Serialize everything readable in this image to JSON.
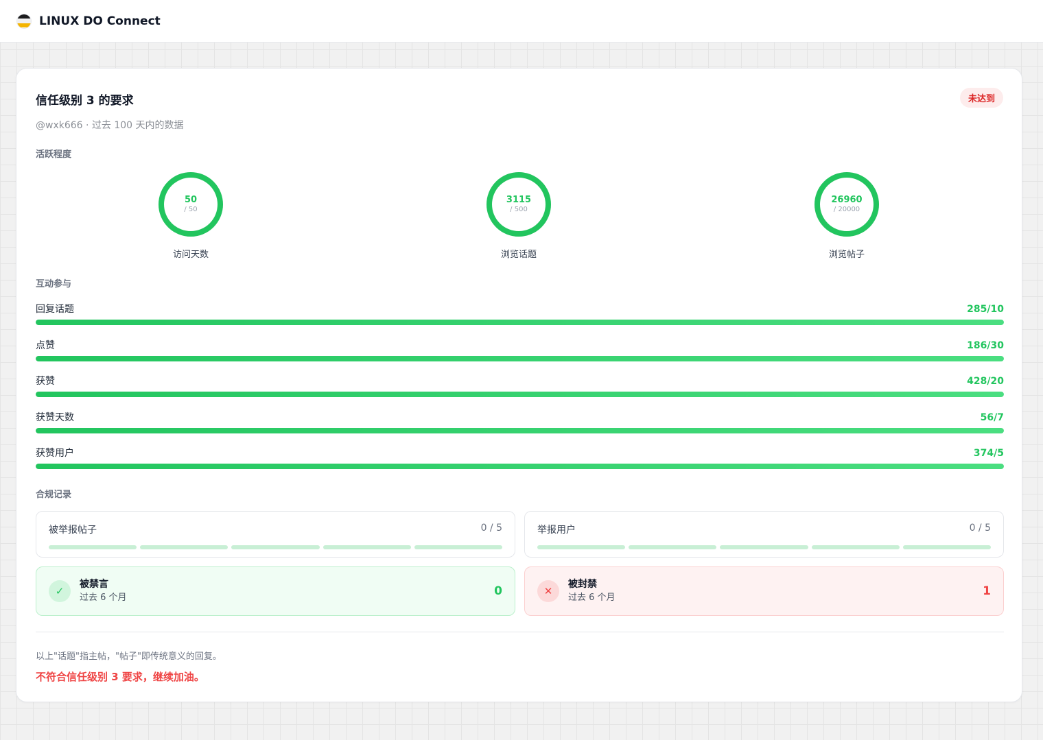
{
  "header": {
    "app_title": "LINUX DO Connect",
    "logo_icon": "linuxdo-logo-icon"
  },
  "card": {
    "title": "信任级别 3 的要求",
    "status_badge": "未达到",
    "subtitle": "@wxk666 · 过去 100 天内的数据"
  },
  "colors": {
    "accent_green": "#22c55e",
    "alert_red": "#ef4444"
  },
  "activity": {
    "section_label": "活跃程度",
    "rings": [
      {
        "value": "50",
        "target": "/ 50",
        "label": "访问天数",
        "progress": 1.0
      },
      {
        "value": "3115",
        "target": "/ 500",
        "label": "浏览话题",
        "progress": 1.0
      },
      {
        "value": "26960",
        "target": "/ 20000",
        "label": "浏览帖子",
        "progress": 1.0
      }
    ]
  },
  "engagement": {
    "section_label": "互动参与",
    "bars": [
      {
        "label": "回复话题",
        "value": "285/10",
        "progress": 1.0
      },
      {
        "label": "点赞",
        "value": "186/30",
        "progress": 1.0
      },
      {
        "label": "获赞",
        "value": "428/20",
        "progress": 1.0
      },
      {
        "label": "获赞天数",
        "value": "56/7",
        "progress": 1.0
      },
      {
        "label": "获赞用户",
        "value": "374/5",
        "progress": 1.0
      }
    ]
  },
  "compliance": {
    "section_label": "合规记录",
    "reported_posts": {
      "label": "被举报帖子",
      "value": "0 / 5",
      "filled_segments": 0,
      "total_segments": 5
    },
    "reported_users": {
      "label": "举报用户",
      "value": "0 / 5",
      "filled_segments": 0,
      "total_segments": 5
    },
    "silenced": {
      "title": "被禁言",
      "sub": "过去 6 个月",
      "value": "0",
      "icon": "check-icon"
    },
    "suspended": {
      "title": "被封禁",
      "sub": "过去 6 个月",
      "value": "1",
      "icon": "close-icon"
    }
  },
  "footer": {
    "note": "以上\"话题\"指主帖，\"帖子\"即传统意义的回复。",
    "verdict": "不符合信任级别 3 要求，继续加油。"
  }
}
